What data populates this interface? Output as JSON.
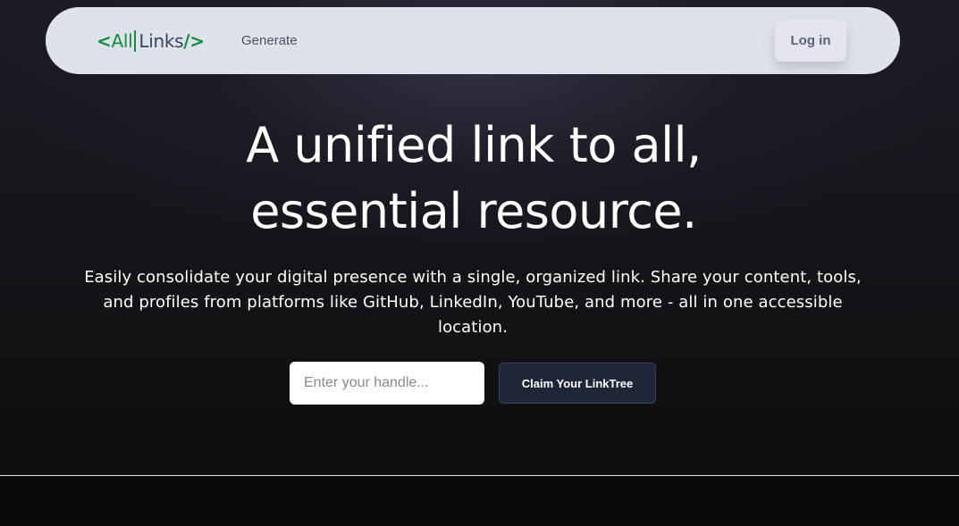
{
  "navbar": {
    "logo": {
      "open_bracket": "<",
      "all": "All",
      "links": "Links",
      "close_bracket": "/>"
    },
    "generate_label": "Generate",
    "login_label": "Log in"
  },
  "hero": {
    "headline_line1": "A unified link to all,",
    "headline_line2": "essential resource.",
    "subtext": "Easily consolidate your digital presence with a single, organized link. Share your content, tools, and profiles from platforms like GitHub, LinkedIn, YouTube, and more - all in one accessible location."
  },
  "form": {
    "handle_placeholder": "Enter your handle...",
    "handle_value": "",
    "claim_label": "Claim Your LinkTree"
  },
  "colors": {
    "logo_green": "#178a3e",
    "navbar_bg": "#dee2ea",
    "claim_button_bg": "#1e2738"
  }
}
